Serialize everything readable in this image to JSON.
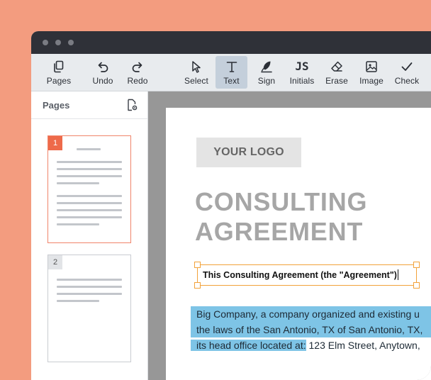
{
  "toolbar": {
    "tools": [
      {
        "label": "Pages",
        "icon": "pages-icon"
      },
      {
        "label": "Undo",
        "icon": "undo-icon"
      },
      {
        "label": "Redo",
        "icon": "redo-icon"
      },
      {
        "label": "Select",
        "icon": "cursor-icon"
      },
      {
        "label": "Text",
        "icon": "text-icon",
        "active": true
      },
      {
        "label": "Sign",
        "icon": "pen-nib-icon"
      },
      {
        "label": "Initials",
        "icon": "initials-icon",
        "glyph": "JS"
      },
      {
        "label": "Erase",
        "icon": "eraser-icon"
      },
      {
        "label": "Image",
        "icon": "image-icon"
      },
      {
        "label": "Check",
        "icon": "checkmark-icon"
      }
    ]
  },
  "sidebar": {
    "title": "Pages",
    "thumbnails": [
      {
        "number": "1",
        "selected": true
      },
      {
        "number": "2",
        "selected": false
      }
    ]
  },
  "document": {
    "logo": "YOUR LOGO",
    "title_line1": "CONSULTING",
    "title_line2": "AGREEMENT",
    "text_field_value": "This Consulting Agreement (the \"Agreement\")",
    "paragraph": {
      "line1": "Big Company, a company organized and existing u",
      "line2": "the laws of the San Antonio, TX of San Antonio, TX,",
      "line3_highlighted": "its head office located at:",
      "line3_rest": " 123 Elm Street, Anytown,"
    }
  },
  "colors": {
    "backdrop": "#f39c7f",
    "active_tool": "#c4cfdb",
    "selection_border": "#f2a23a",
    "highlight": "#7ec4e6",
    "thumb_accent": "#ee6a4a"
  }
}
